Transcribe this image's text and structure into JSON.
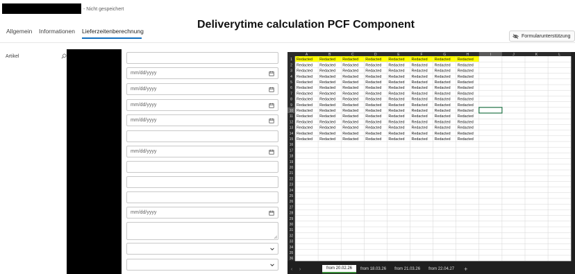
{
  "header": {
    "record_status": "- Nicht gespeichert",
    "page_title": "Deliverytime calculation PCF Component",
    "form_assist_label": "Formularunterstützung"
  },
  "tabs": [
    {
      "label": "Allgemein",
      "active": false
    },
    {
      "label": "Informationen",
      "active": false
    },
    {
      "label": "Lieferzeitenberechnung",
      "active": true
    }
  ],
  "form": {
    "artikel_label": "Artikel",
    "date_placeholder": "mm/dd/yyyy"
  },
  "spreadsheet": {
    "columns": [
      "A",
      "B",
      "C",
      "D",
      "E",
      "F",
      "G",
      "H",
      "I",
      "J",
      "K",
      "L"
    ],
    "row_count": 36,
    "data_rows": 15,
    "data_cols": 8,
    "cell_text": "Redacted",
    "highlight_row": 1,
    "highlight_color": "#ffff00",
    "selected_column": "I",
    "selected_row": 10,
    "sheet_tabs": [
      {
        "label": "from 20.02.26",
        "active": true
      },
      {
        "label": "from 18.03.26",
        "active": false
      },
      {
        "label": "from 21.03.26",
        "active": false
      },
      {
        "label": "from 22.04.27",
        "active": false
      }
    ],
    "add_sheet_label": "+"
  },
  "colors": {
    "accent": "#0f6cbd",
    "selection_border": "#217346",
    "sheet_background": "#1f1f1f"
  }
}
